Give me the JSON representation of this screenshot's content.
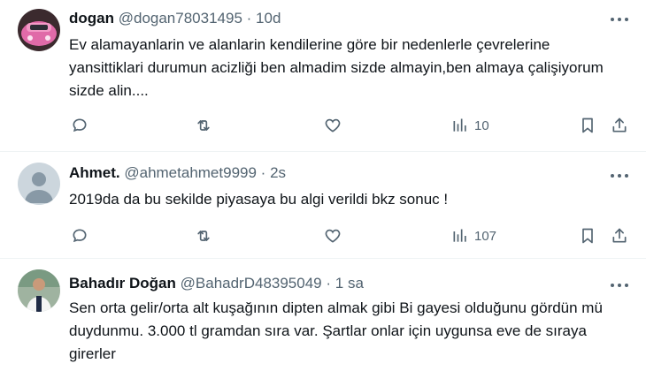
{
  "tweets": [
    {
      "name": "dogan",
      "handle": "@dogan78031495",
      "sep": "·",
      "time": "10d",
      "text": "Ev alamayanlarin ve alanlarin kendilerine göre bir nedenlerle çevrelerine yansittiklari durumun acizliği ben almadim sizde almayin,ben almaya çalişiyorum sizde alin....",
      "views": "10"
    },
    {
      "name": "Ahmet.",
      "handle": "@ahmetahmet9999",
      "sep": "·",
      "time": "2s",
      "text": "2019da da bu sekilde piyasaya bu algi verildi bkz sonuc !",
      "views": "107"
    },
    {
      "name": "Bahadır Doğan",
      "handle": "@BahadrD48395049",
      "sep": "·",
      "time": "1 sa",
      "text": "Sen orta gelir/orta alt kuşağının dipten almak gibi Bi gayesi olduğunu gördün mü duydunmu. 3.000 tl gramdan sıra var. Şartlar onlar için uygunsa eve de sıraya girerler"
    }
  ],
  "icons": {
    "reply": "reply-icon",
    "retweet": "retweet-icon",
    "like": "heart-icon",
    "views": "views-icon",
    "bookmark": "bookmark-icon",
    "share": "share-icon",
    "more": "more-icon"
  },
  "colors": {
    "text": "#0f1419",
    "secondary": "#536471",
    "divider": "#eff3f4"
  }
}
